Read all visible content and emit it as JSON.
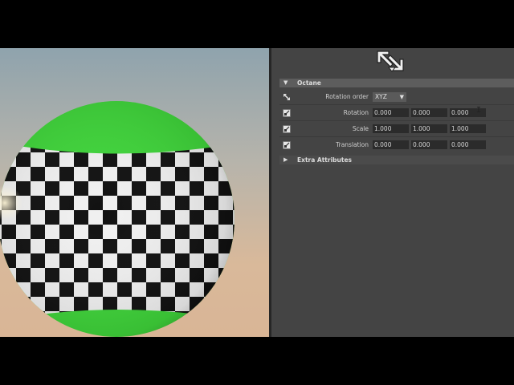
{
  "colors": {
    "panel_bg": "#444444",
    "section_header_bg": "#5d5d5d",
    "field_bg": "#2b2b2b",
    "sphere_cap": "#3fd43a",
    "checker_dark": "#111111",
    "checker_light": "#f0f0f0"
  },
  "icons": {
    "node": "transform-node-icon",
    "row": "connect-attribute-icon"
  },
  "octane": {
    "title": "Octane",
    "rotation_order": {
      "label": "Rotation order",
      "value": "XYZ"
    },
    "rows": [
      {
        "label": "Rotation",
        "values": [
          "0.000",
          "0.000",
          "0.000"
        ]
      },
      {
        "label": "Scale",
        "values": [
          "1.000",
          "1.000",
          "1.000"
        ]
      },
      {
        "label": "Translation",
        "values": [
          "0.000",
          "0.000",
          "0.000"
        ]
      }
    ]
  },
  "extra_attributes": {
    "title": "Extra Attributes"
  }
}
